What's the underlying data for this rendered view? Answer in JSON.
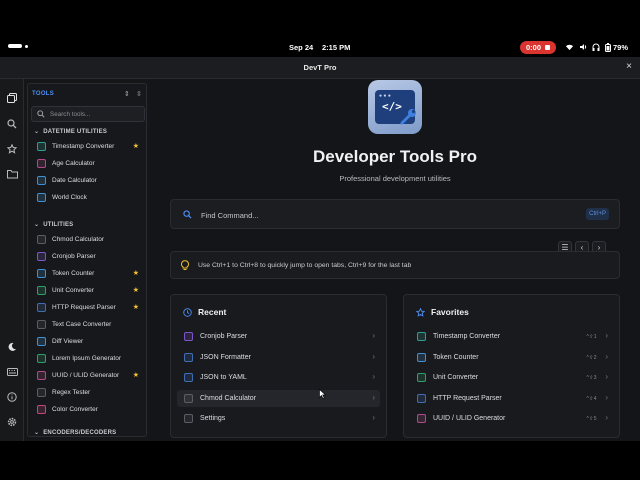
{
  "status": {
    "date": "Sep 24",
    "time": "2:15 PM",
    "recording": "0:00",
    "battery": "79%"
  },
  "window": {
    "title": "DevT Pro",
    "close": "×"
  },
  "sidebar": {
    "header": "TOOLS",
    "search_placeholder": "Search tools...",
    "sections": [
      {
        "title": "DATETIME UTILITIES",
        "items": [
          {
            "label": "Timestamp Converter",
            "star": "★",
            "color": "#2f9e8f"
          },
          {
            "label": "Age Calculator",
            "star": "",
            "color": "#b04a8a"
          },
          {
            "label": "Date Calculator",
            "star": "",
            "color": "#3f8fd2"
          },
          {
            "label": "World Clock",
            "star": "",
            "color": "#3f8fd2"
          }
        ]
      },
      {
        "title": "UTILITIES",
        "items": [
          {
            "label": "Chmod Calculator",
            "star": "",
            "color": "#5a5d64"
          },
          {
            "label": "Cronjob Parser",
            "star": "",
            "color": "#7b56c9"
          },
          {
            "label": "Token Counter",
            "star": "★",
            "color": "#3f8fd2"
          },
          {
            "label": "Unit Converter",
            "star": "★",
            "color": "#2f9e6a"
          },
          {
            "label": "HTTP Request Parser",
            "star": "★",
            "color": "#3f6fb2"
          },
          {
            "label": "Text Case Converter",
            "star": "",
            "color": "#5a5d64"
          },
          {
            "label": "Diff Viewer",
            "star": "",
            "color": "#3f8fd2"
          },
          {
            "label": "Lorem Ipsum Generator",
            "star": "",
            "color": "#2f9e6a"
          },
          {
            "label": "UUID / ULID Generator",
            "star": "★",
            "color": "#b04a8a"
          },
          {
            "label": "Regex Tester",
            "star": "",
            "color": "#5a5d64"
          },
          {
            "label": "Color Converter",
            "star": "",
            "color": "#c4467a"
          }
        ]
      },
      {
        "title": "ENCODERS/DECODERS",
        "items": []
      }
    ]
  },
  "main": {
    "app_name": "Developer Tools Pro",
    "subtitle": "Professional development utilities",
    "logo_text": "</>",
    "command_placeholder": "Find Command...",
    "command_shortcut": "Ctrl+P",
    "tip": "Use Ctrl+1 to Ctrl+8 to quickly jump to open tabs, Ctrl+9 for the last tab",
    "recent": {
      "title": "Recent",
      "items": [
        {
          "label": "Cronjob Parser",
          "color": "#7b56c9"
        },
        {
          "label": "JSON Formatter",
          "color": "#3f6fb2"
        },
        {
          "label": "JSON to YAML",
          "color": "#3f6fb2"
        },
        {
          "label": "Chmod Calculator",
          "color": "#5a5d64"
        },
        {
          "label": "Settings",
          "color": "#5a5d64"
        }
      ]
    },
    "favorites": {
      "title": "Favorites",
      "items": [
        {
          "label": "Timestamp Converter",
          "shortcut": "^⇧1",
          "color": "#2f9e8f"
        },
        {
          "label": "Token Counter",
          "shortcut": "^⇧2",
          "color": "#3f8fd2"
        },
        {
          "label": "Unit Converter",
          "shortcut": "^⇧3",
          "color": "#2f9e6a"
        },
        {
          "label": "HTTP Request Parser",
          "shortcut": "^⇧4",
          "color": "#3f6fb2"
        },
        {
          "label": "UUID / ULID Generator",
          "shortcut": "^⇧5",
          "color": "#b04a8a"
        }
      ]
    }
  },
  "colors": {
    "accent": "#4d8ff7",
    "star": "#f2c230",
    "record": "#d9342f"
  }
}
